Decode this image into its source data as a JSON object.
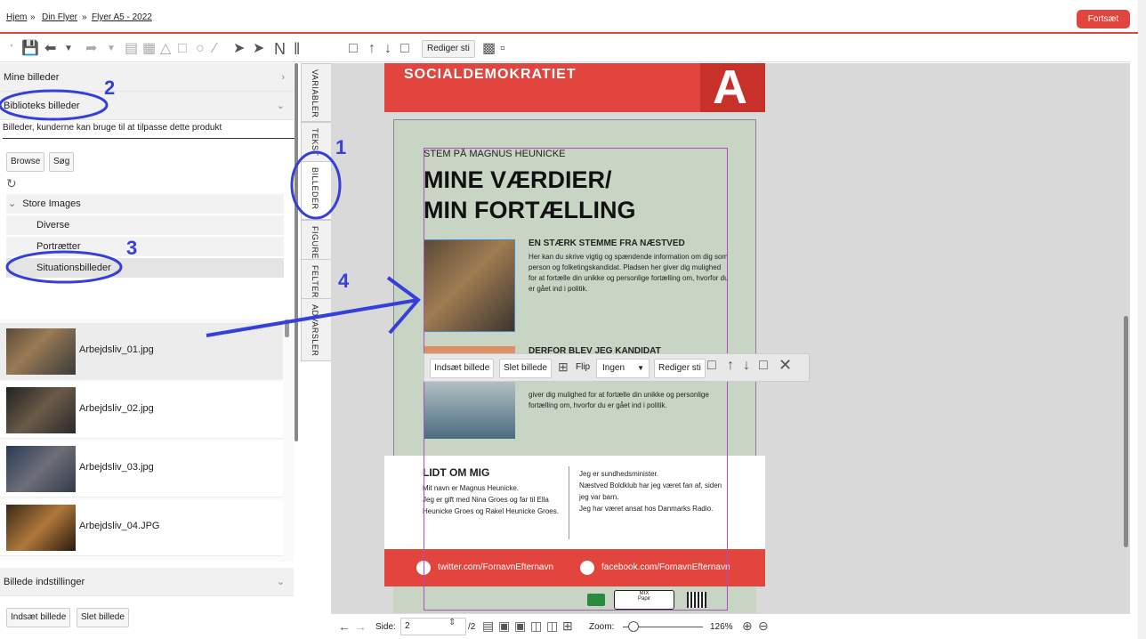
{
  "breadcrumb": {
    "home": "Hjem",
    "sep1": "»",
    "item1": "Din Flyer",
    "sep2": "»",
    "item2": "Flyer A5 - 2022"
  },
  "continue_label": "Fortsæt",
  "toolbar": {
    "edit_path": "Rediger sti"
  },
  "left": {
    "my_images": "Mine billeder",
    "library_images": "Biblioteks billeder",
    "library_desc": "Billeder, kunderne kan bruge til at tilpasse dette produkt",
    "browse": "Browse",
    "search": "Søg",
    "tree_root": "Store Images",
    "tree_items": [
      "Diverse",
      "Portrætter",
      "Situationsbilleder"
    ],
    "images": [
      "Arbejdsliv_01.jpg",
      "Arbejdsliv_02.jpg",
      "Arbejdsliv_03.jpg",
      "Arbejdsliv_04.JPG"
    ],
    "image_settings": "Billede indstillinger",
    "insert_image": "Indsæt billede",
    "delete_image": "Slet billede"
  },
  "tabs": [
    "VARIABLER",
    "TEKST",
    "BILLEDER",
    "FIGURERE",
    "FELTER",
    "ADVARSLER"
  ],
  "annotations": [
    "1",
    "2",
    "3",
    "4"
  ],
  "flyer": {
    "party": "SOCIALDEMOKRATIET",
    "party_letter": "A",
    "kicker": "STEM PÅ MAGNUS HEUNICKE",
    "title1": "MINE VÆRDIER/",
    "title2": "MIN FORTÆLLING",
    "sec1_title": "EN STÆRK STEMME FRA NÆSTVED",
    "sec1_body": "Her kan du skrive vigtig og spændende information om dig som person og folketingskandidat. Pladsen her giver dig mulighed for at fortælle din unikke og personlige fortælling om, hvorfor du er gået ind i politik.",
    "sec2_title": "DERFOR BLEV JEG KANDIDAT",
    "sec2_body": "giver dig mulighed for at fortælle din unikke og personlige fortælling om, hvorfor du er gået ind i politik.",
    "about_title": "LIDT OM MIG",
    "about_left": [
      "Mit navn er Magnus Heunicke.",
      "Jeg er gift med Nina Groes og far til Ella Heunicke Groes og Rakel Heunicke Groes."
    ],
    "about_right": [
      "Jeg er sundhedsminister.",
      "Næstved Boldklub har jeg været fan af, siden jeg var barn.",
      "Jeg har været ansat hos Danmarks Radio."
    ],
    "twitter": "twitter.com/FornavnEfternavn",
    "facebook": "facebook.com/FornavnEfternavn",
    "mix": "MIX",
    "paper": "Papir"
  },
  "floating": {
    "insert": "Indsæt billede",
    "delete": "Slet billede",
    "flip": "Flip",
    "flip_value": "Ingen",
    "edit_path": "Rediger sti"
  },
  "bottom": {
    "side_label": "Side:",
    "page_value": "2",
    "page_total": "/2",
    "zoom_label": "Zoom:",
    "zoom_value": "126%"
  },
  "colors": {
    "accent": "#e1453d",
    "annotation": "#3540dc",
    "flyer_bg": "#c8d5c4"
  }
}
